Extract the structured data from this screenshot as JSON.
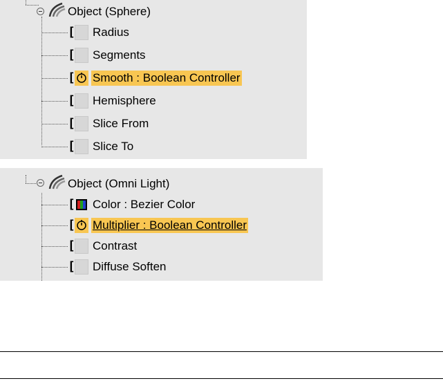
{
  "panel1": {
    "object": {
      "label": "Object (Sphere)",
      "icon": "object-modifier-icon"
    },
    "items": [
      {
        "label": "Radius",
        "selected": false,
        "underline": false,
        "icon": "empty-controller-slot"
      },
      {
        "label": "Segments",
        "selected": false,
        "underline": false,
        "icon": "empty-controller-slot"
      },
      {
        "label": "Smooth : Boolean Controller",
        "selected": true,
        "underline": false,
        "icon": "boolean-controller-icon"
      },
      {
        "label": "Hemisphere",
        "selected": false,
        "underline": false,
        "icon": "empty-controller-slot"
      },
      {
        "label": "Slice From",
        "selected": false,
        "underline": false,
        "icon": "empty-controller-slot"
      },
      {
        "label": "Slice To",
        "selected": false,
        "underline": false,
        "icon": "empty-controller-slot"
      }
    ]
  },
  "panel2": {
    "object": {
      "label": "Object (Omni Light)",
      "icon": "object-modifier-icon"
    },
    "items": [
      {
        "label": "Color : Bezier Color",
        "selected": false,
        "underline": false,
        "icon": "color-controller-icon"
      },
      {
        "label": "Multiplier : Boolean Controller",
        "selected": true,
        "underline": true,
        "icon": "boolean-controller-icon"
      },
      {
        "label": "Contrast",
        "selected": false,
        "underline": false,
        "icon": "empty-controller-slot"
      },
      {
        "label": "Diffuse Soften",
        "selected": false,
        "underline": false,
        "icon": "empty-controller-slot"
      }
    ]
  },
  "colors": {
    "panel_bg": "#e7e7e7",
    "selection": "#f8c652",
    "slot": "#d7d7d7"
  }
}
